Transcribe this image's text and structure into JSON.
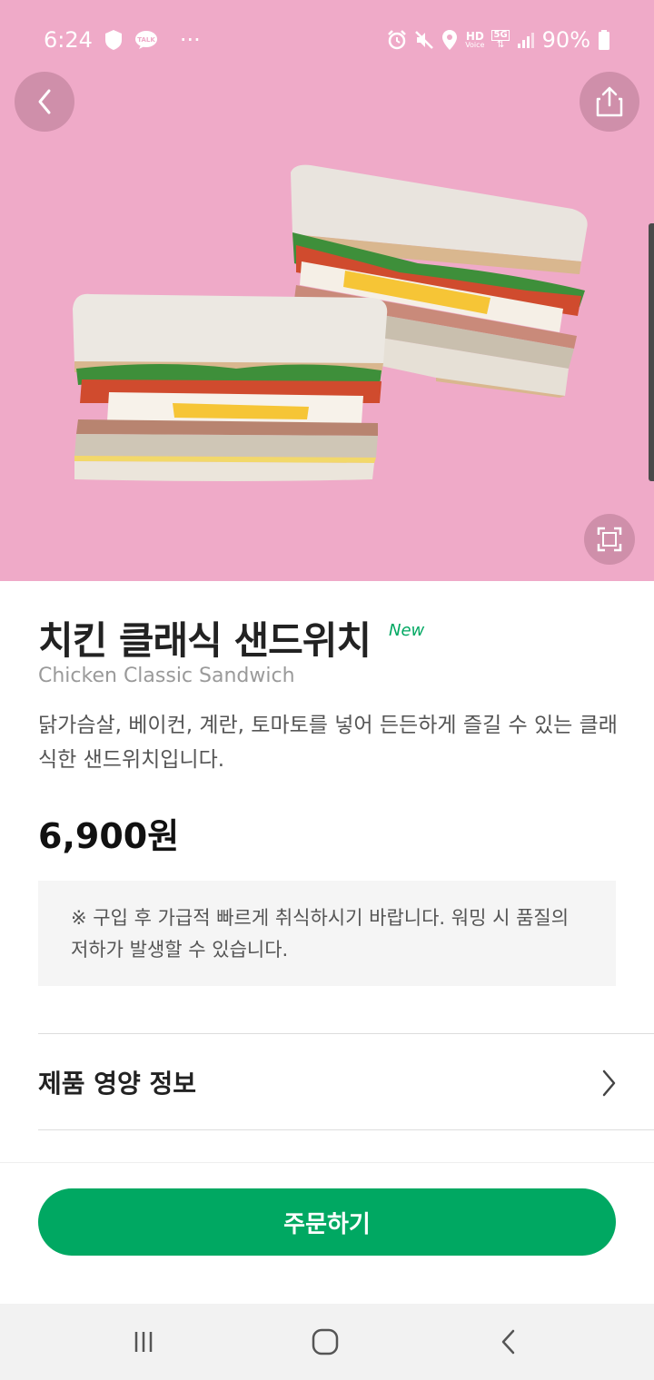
{
  "status_bar": {
    "time": "6:24",
    "battery": "90%",
    "icons": [
      "shield-icon",
      "kakaotalk-icon",
      "more-icon",
      "alarm-icon",
      "mute-icon",
      "location-icon",
      "hd-voice-icon",
      "5g-icon",
      "signal-icon",
      "battery-icon"
    ],
    "hd_label": "HD",
    "voice_label": "Voice",
    "network_label": "5G",
    "talk_label": "TALK",
    "dots": "···"
  },
  "hero": {
    "background": "#efaac8",
    "back_icon": "chevron-left-icon",
    "share_icon": "share-icon",
    "fullscreen_icon": "fullscreen-icon"
  },
  "product": {
    "name_ko": "치킨 클래식 샌드위치",
    "badge": "New",
    "name_en": "Chicken Classic Sandwich",
    "description": "닭가슴살, 베이컨, 계란, 토마토를 넣어 든든하게 즐길 수 있는 클래식한 샌드위치입니다.",
    "price": "6,900원"
  },
  "notice": {
    "text": "※ 구입 후 가급적 빠르게 취식하시기 바랍니다. 워밍 시 품질의 저하가 발생할 수 있습니다."
  },
  "nutrition": {
    "label": "제품 영양 정보",
    "chevron_icon": "chevron-right-icon"
  },
  "order_button": {
    "label": "주문하기",
    "color": "#00a862"
  },
  "nav_bar": {
    "icons": [
      "recent-apps-icon",
      "home-icon",
      "back-icon"
    ]
  }
}
